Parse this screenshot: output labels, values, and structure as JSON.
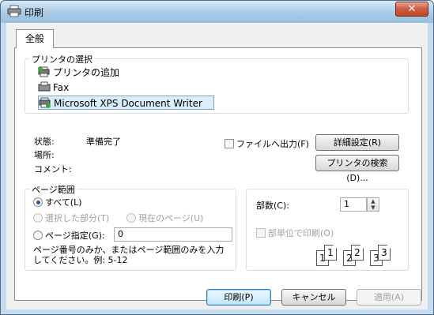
{
  "window": {
    "title": "印刷",
    "close_glyph": "✕"
  },
  "tab": {
    "label": "全般"
  },
  "printer_group": {
    "label": "プリンタの選択",
    "items": [
      {
        "label": "プリンタの追加",
        "icon": "add-printer-icon"
      },
      {
        "label": "Fax",
        "icon": "fax-icon"
      },
      {
        "label": "Microsoft XPS Document Writer",
        "icon": "printer-icon",
        "selected": true
      }
    ],
    "status_label": "状態:",
    "status_value": "準備完了",
    "location_label": "場所:",
    "comment_label": "コメント:",
    "print_to_file_label": "ファイルへ出力(F)",
    "preferences_button": "詳細設定(R)",
    "find_printer_button": "プリンタの検索(D)..."
  },
  "page_range_group": {
    "label": "ページ範囲",
    "all_label": "すべて(L)",
    "selection_label": "選択した部分(T)",
    "current_page_label": "現在のページ(U)",
    "pages_label": "ページ指定(G):",
    "pages_value": "0",
    "hint": "ページ番号のみか、またはページ範囲のみを入力してください。例: 5-12"
  },
  "copies_group": {
    "copies_label": "部数(C):",
    "copies_value": "1",
    "collate_label": "部単位で印刷(O)",
    "collate_pages": [
      "1",
      "1",
      "2",
      "2",
      "3",
      "3"
    ]
  },
  "buttons": {
    "print": "印刷(P)",
    "cancel": "キャンセル",
    "apply": "適用(A)"
  },
  "colors": {
    "accent": "#3c7fb1",
    "selection": "#dceefc"
  }
}
